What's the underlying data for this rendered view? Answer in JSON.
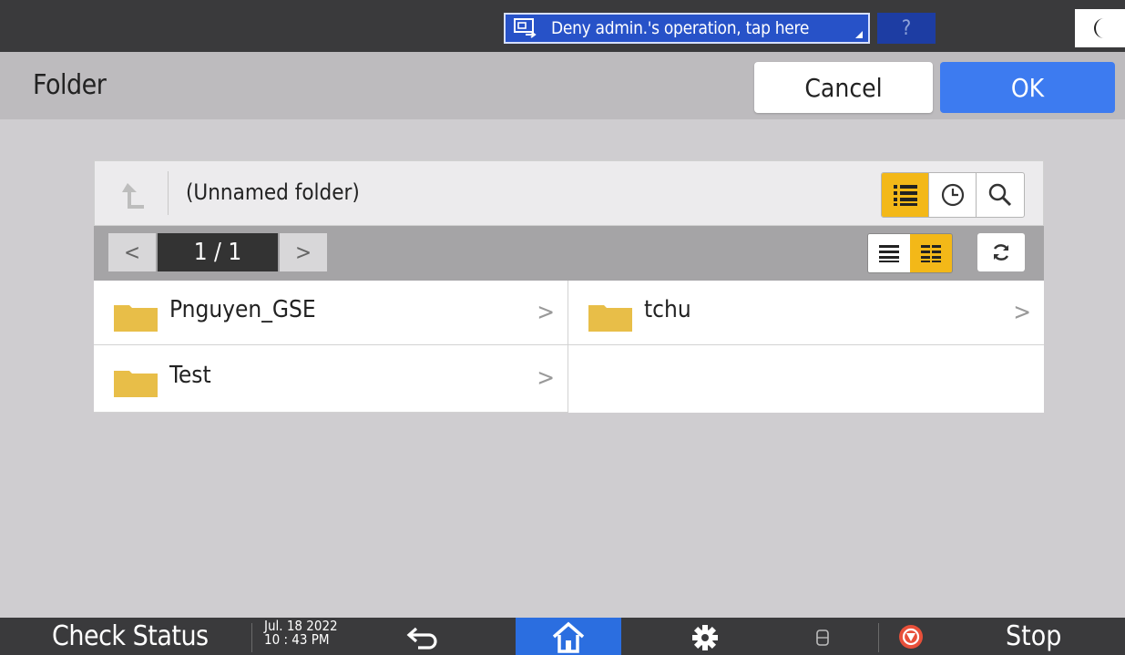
{
  "status_bar": {
    "remote_notice": "Deny admin.'s operation, tap here",
    "help_label": "?",
    "remote_icon": "remote-screen-icon",
    "night_icon": "moon-icon"
  },
  "header": {
    "title": "Folder",
    "cancel_label": "Cancel",
    "ok_label": "OK"
  },
  "folder_panel": {
    "current_path": "(Unnamed folder)",
    "page_indicator": "1 / 1",
    "prev_label": "<",
    "next_label": ">",
    "mode_buttons": [
      "list-icon",
      "clock-icon",
      "search-icon"
    ],
    "view_buttons": [
      "list-view-icon",
      "detail-view-icon"
    ],
    "refresh_icon": "refresh-icon",
    "items": [
      {
        "name": "Pnguyen_GSE",
        "icon": "folder-icon"
      },
      {
        "name": "tchu",
        "icon": "folder-icon"
      },
      {
        "name": "Test",
        "icon": "folder-icon"
      }
    ]
  },
  "bottom_bar": {
    "check_status_label": "Check Status",
    "date": "Jul. 18 2022",
    "time": "10 : 43 PM",
    "stop_label": "Stop"
  },
  "colors": {
    "accent_blue": "#3d7bf0",
    "active_yellow": "#f3b818",
    "top_bar": "#3a3a3c",
    "background": "#cfcdd0"
  }
}
